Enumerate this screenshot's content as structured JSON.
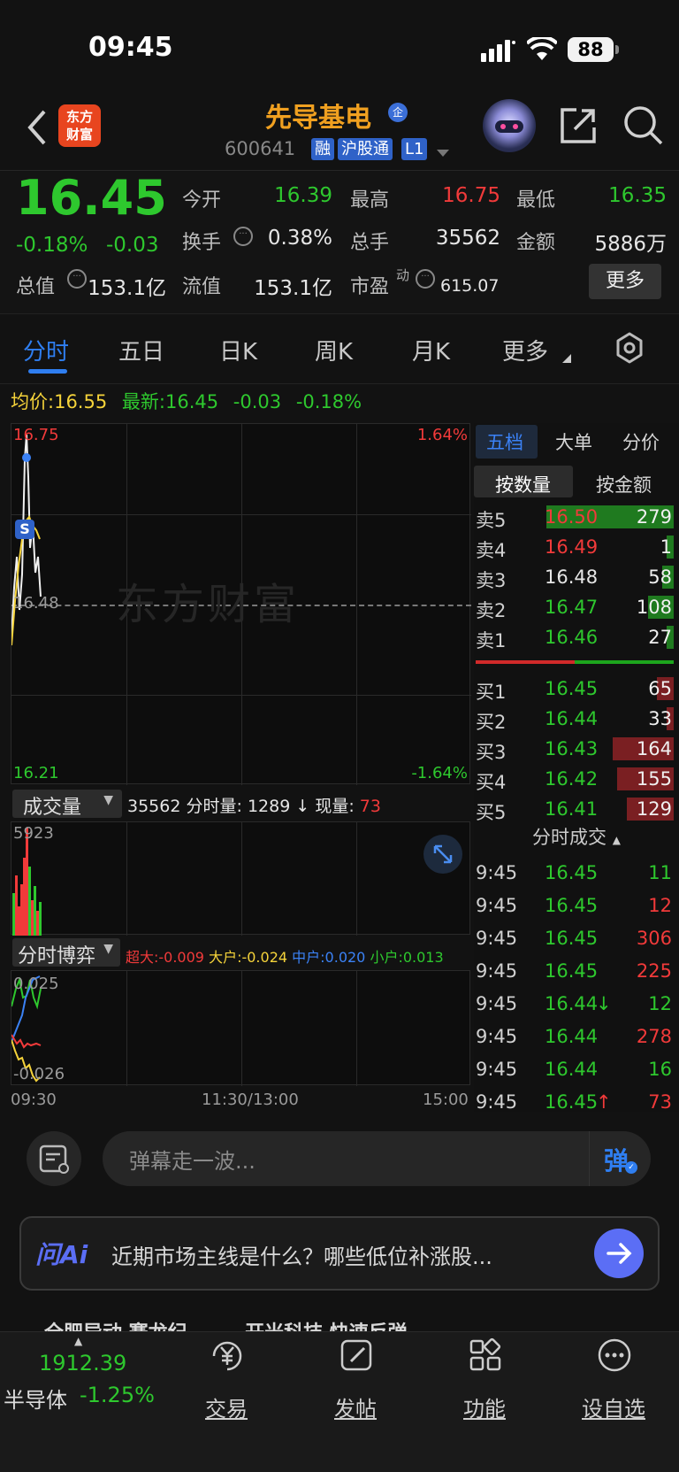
{
  "status": {
    "time": "09:45",
    "battery": "88"
  },
  "header": {
    "logo_text": "东方\n财富",
    "stock_name": "先导基电",
    "name_badge": "企",
    "code": "600641",
    "tags": [
      "融",
      "沪股通",
      "L1"
    ]
  },
  "quote": {
    "price": "16.45",
    "change_pct": "-0.18%",
    "change": "-0.03",
    "open_label": "今开",
    "open": "16.39",
    "high_label": "最高",
    "high": "16.75",
    "low_label": "最低",
    "low": "16.35",
    "turnover_label": "换手",
    "turnover": "0.38%",
    "volume_label": "总手",
    "volume": "35562",
    "amount_label": "金额",
    "amount": "5886万",
    "mktcap_label": "总值",
    "mktcap": "153.1亿",
    "float_label": "流值",
    "float": "153.1亿",
    "pe_label": "市盈",
    "pe_sup": "动",
    "pe": "615.07",
    "more": "更多"
  },
  "tabs": [
    "分时",
    "五日",
    "日K",
    "周K",
    "月K",
    "更多"
  ],
  "avg": {
    "avg_label": "均价:",
    "avg": "16.55",
    "latest_label": "最新:",
    "latest": "16.45",
    "chg": "-0.03",
    "pct": "-0.18%"
  },
  "price_chart": {
    "y_top": "16.75",
    "y_mid": "16.48",
    "y_bot": "16.21",
    "pct_top": "1.64%",
    "pct_bot": "-1.64%",
    "marker": "S",
    "watermark": "东方财富"
  },
  "volume_chart": {
    "selector": "成交量",
    "total": "35562",
    "fenshi_label": "分时量:",
    "fenshi": "1289",
    "now_label": "现量:",
    "now": "73",
    "y_max": "5923"
  },
  "flow_chart": {
    "selector": "分时博弈",
    "super": "超大:-0.009",
    "large": "大户:-0.024",
    "mid": "中户:0.020",
    "small": "小户:0.013",
    "y_top": "0.025",
    "y_bot": "-0.026"
  },
  "time_axis": [
    "09:30",
    "11:30/13:00",
    "15:00"
  ],
  "orderbook": {
    "tabs": [
      "五档",
      "大单",
      "分价"
    ],
    "subtabs": [
      "按数量",
      "按金额"
    ],
    "asks": [
      {
        "label": "卖5",
        "price": "16.50",
        "qty": "279",
        "bar": 0.9
      },
      {
        "label": "卖4",
        "price": "16.49",
        "qty": "1",
        "bar": 0.0
      },
      {
        "label": "卖3",
        "price": "16.48",
        "qty": "58",
        "bar": 0.08
      },
      {
        "label": "卖2",
        "price": "16.47",
        "qty": "108",
        "bar": 0.18
      },
      {
        "label": "卖1",
        "price": "16.46",
        "qty": "27",
        "bar": 0.05
      }
    ],
    "bids": [
      {
        "label": "买1",
        "price": "16.45",
        "qty": "65",
        "bar": 0.12
      },
      {
        "label": "买2",
        "price": "16.44",
        "qty": "33",
        "bar": 0.05
      },
      {
        "label": "买3",
        "price": "16.43",
        "qty": "164",
        "bar": 0.43
      },
      {
        "label": "买4",
        "price": "16.42",
        "qty": "155",
        "bar": 0.4
      },
      {
        "label": "买5",
        "price": "16.41",
        "qty": "129",
        "bar": 0.33
      }
    ],
    "ticks_title": "分时成交",
    "ticks": [
      {
        "time": "9:45",
        "price": "16.45",
        "qty": "11",
        "qcolor": "g",
        "arrow": ""
      },
      {
        "time": "9:45",
        "price": "16.45",
        "qty": "12",
        "qcolor": "r",
        "arrow": ""
      },
      {
        "time": "9:45",
        "price": "16.45",
        "qty": "306",
        "qcolor": "r",
        "arrow": ""
      },
      {
        "time": "9:45",
        "price": "16.45",
        "qty": "225",
        "qcolor": "r",
        "arrow": ""
      },
      {
        "time": "9:45",
        "price": "16.44",
        "qty": "12",
        "qcolor": "g",
        "arrow": "↓"
      },
      {
        "time": "9:45",
        "price": "16.44",
        "qty": "278",
        "qcolor": "r",
        "arrow": ""
      },
      {
        "time": "9:45",
        "price": "16.44",
        "qty": "16",
        "qcolor": "g",
        "arrow": ""
      },
      {
        "time": "9:45",
        "price": "16.45",
        "qty": "73",
        "qcolor": "r",
        "arrow": "↑"
      }
    ]
  },
  "comment": {
    "placeholder": "弹幕走一波...",
    "send": "弹"
  },
  "ai": {
    "logo": "问Ai",
    "prompt": "近期市场主线是什么？哪些低位补涨股..."
  },
  "ticker_strip": {
    "text": "全肥异动  赛龙纪...  ...  开米科技  快速反弹"
  },
  "bottom_nav": {
    "index_value": "1912.39",
    "index_name": "半导体",
    "index_pct": "-1.25%",
    "items": [
      "交易",
      "发帖",
      "功能",
      "设自选"
    ]
  }
}
